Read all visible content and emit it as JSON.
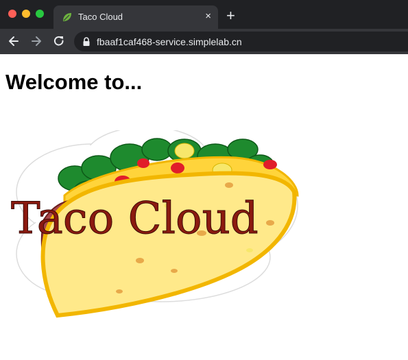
{
  "browser": {
    "tab": {
      "title": "Taco Cloud",
      "favicon": "leaf-icon",
      "close_glyph": "×"
    },
    "new_tab_glyph": "+",
    "address_bar": {
      "url": "fbaaf1caf468-service.simplelab.cn",
      "secure_icon": "lock-icon"
    },
    "nav_icons": [
      "back-arrow-icon",
      "forward-arrow-icon",
      "reload-icon"
    ],
    "window_controls": {
      "close_color": "#ff5f57",
      "minimize_color": "#febc2e",
      "maximize_color": "#28c840"
    }
  },
  "page": {
    "heading": "Welcome to...",
    "logo": {
      "text": "Taco Cloud",
      "text_color": "#8b1a10"
    }
  }
}
